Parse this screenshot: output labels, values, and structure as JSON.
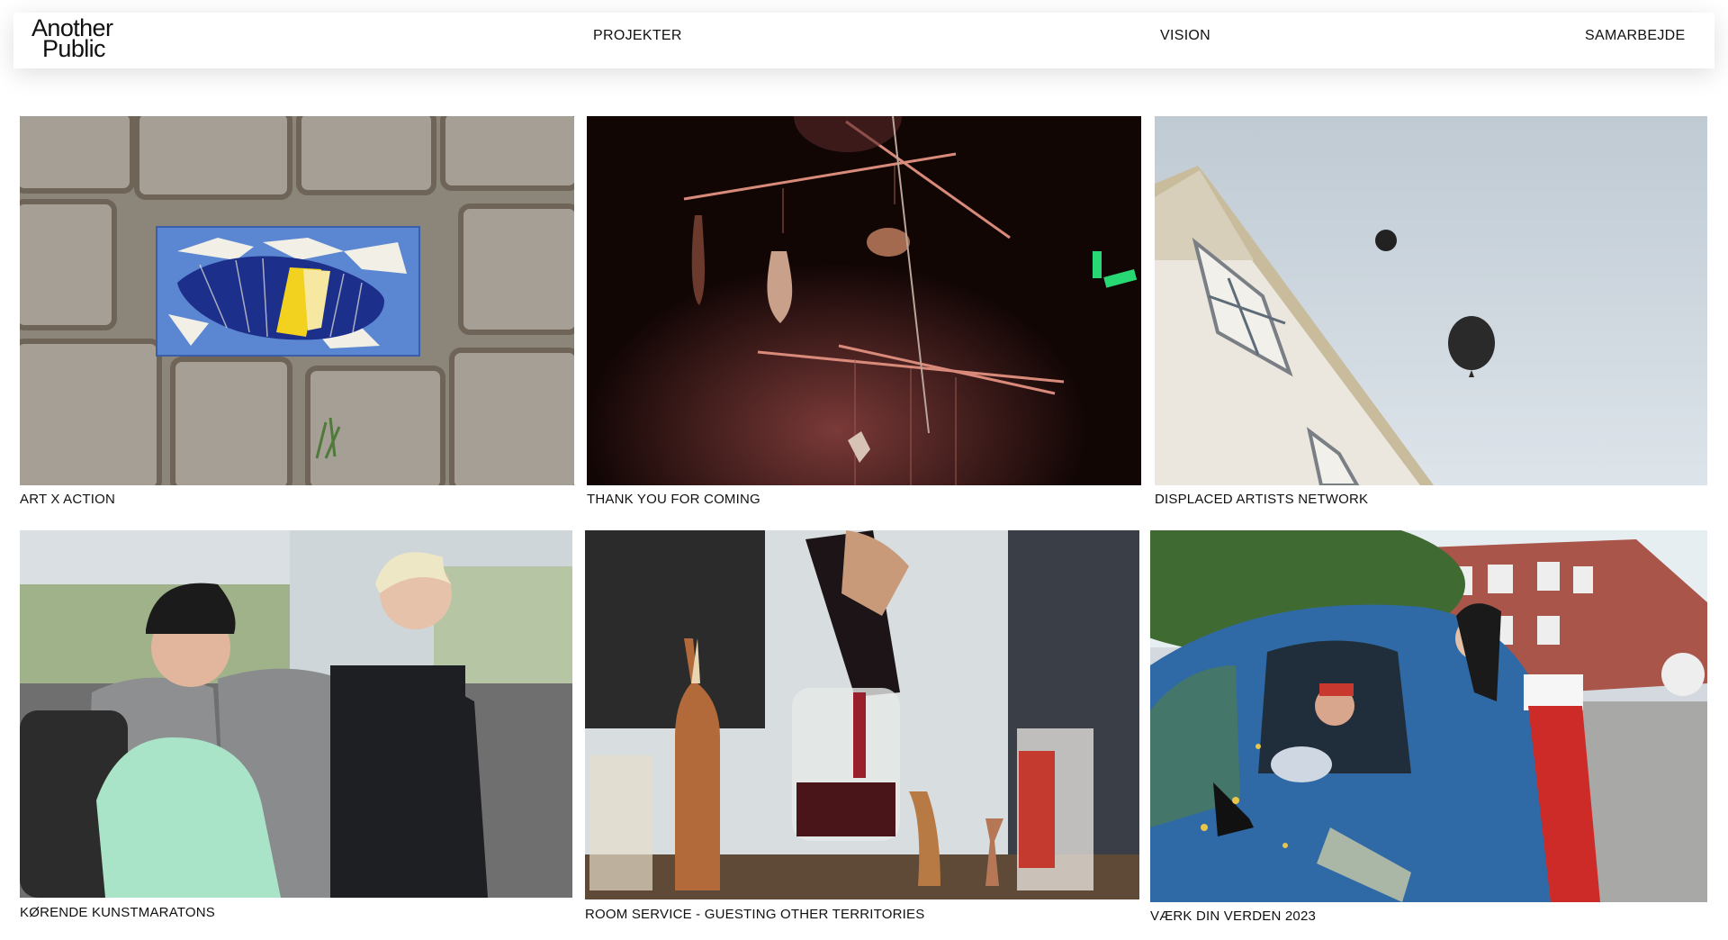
{
  "brand": {
    "line1": "Another",
    "line2": "Public"
  },
  "nav": {
    "projects": "PROJEKTER",
    "vision": "VISION",
    "collaborate": "SAMARBEJDE"
  },
  "projects": [
    {
      "title": "ART X ACTION",
      "image": "mosaic-on-cobblestones"
    },
    {
      "title": "THANK YOU FOR COMING",
      "image": "hanging-mobile-sculpture"
    },
    {
      "title": "DISPLACED ARTISTS NETWORK",
      "image": "house-with-balloons"
    },
    {
      "title": "KØRENDE KUNSTMARATONS",
      "image": "people-on-bus"
    },
    {
      "title": "ROOM SERVICE - GUESTING OTHER TERRITORIES",
      "image": "bottles-and-jars"
    },
    {
      "title": "VÆRK DIN VERDEN 2023",
      "image": "decorated-blue-car"
    }
  ]
}
